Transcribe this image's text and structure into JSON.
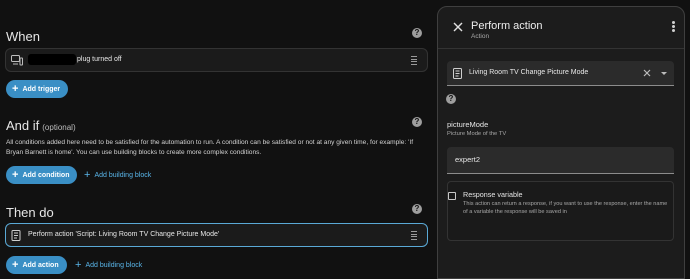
{
  "when": {
    "title": "When",
    "trigger_text": "plug turned off",
    "add_trigger_label": "Add trigger"
  },
  "and_if": {
    "title": "And if",
    "optional_label": "(optional)",
    "description": "All conditions added here need to be satisfied for the automation to run. A condition can be satisfied or not at any given time, for example: 'If Bryan Barnett is home'. You can use building blocks to create more complex conditions.",
    "add_condition_label": "Add condition",
    "add_building_block_label": "Add building block"
  },
  "then_do": {
    "title": "Then do",
    "action_text": "Perform action 'Script: Living Room TV Change Picture Mode'",
    "add_action_label": "Add action",
    "add_building_block_label": "Add building block"
  },
  "panel": {
    "title": "Perform action",
    "subtitle": "Action",
    "action_value": "Living Room TV Change Picture Mode",
    "field_label": "pictureMode",
    "field_help": "Picture Mode of the TV",
    "field_value": "expert2",
    "response_title": "Response variable",
    "response_desc": "This action can return a response, if you want to use the response, enter the name of a variable the response will be saved in"
  },
  "icons": [
    "device-trigger-icon",
    "help-icon",
    "drag-handle-icon",
    "script-icon",
    "close-icon",
    "more-vert-icon",
    "clear-icon",
    "dropdown-caret-icon",
    "checkbox-icon",
    "plus-icon"
  ],
  "colors": {
    "accent": "#3a8fc5",
    "link": "#5ab6ea",
    "selected_border": "#5aa9d6",
    "background": "#111111",
    "panel": "#1c1c1c"
  }
}
